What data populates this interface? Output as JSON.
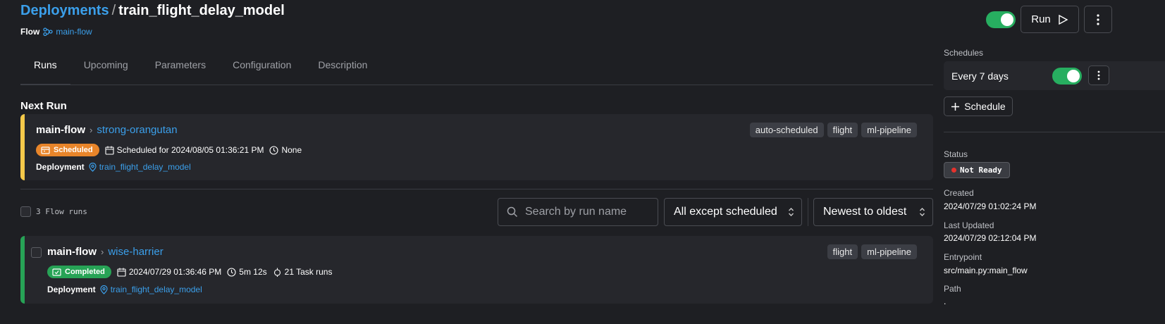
{
  "header": {
    "breadcrumb_root": "Deployments",
    "breadcrumb_sep": "/",
    "deployment_name": "train_flight_delay_model",
    "flow_label": "Flow",
    "flow_name": "main-flow",
    "run_button": "Run"
  },
  "tabs": [
    {
      "label": "Runs",
      "active": true
    },
    {
      "label": "Upcoming"
    },
    {
      "label": "Parameters"
    },
    {
      "label": "Configuration"
    },
    {
      "label": "Description"
    }
  ],
  "next_run": {
    "section_title": "Next Run",
    "flow": "main-flow",
    "run_name": "strong-orangutan",
    "state": "Scheduled",
    "state_color": "#e8852a",
    "scheduled_text": "Scheduled for 2024/08/05 01:36:21 PM",
    "duration": "None",
    "deployment_label": "Deployment",
    "deployment": "train_flight_delay_model",
    "tags": [
      "auto-scheduled",
      "flight",
      "ml-pipeline"
    ]
  },
  "runs_list": {
    "count_label": "3 Flow runs",
    "search_placeholder": "Search by run name",
    "filter_value": "All except scheduled",
    "sort_value": "Newest to oldest"
  },
  "runs": [
    {
      "flow": "main-flow",
      "run_name": "wise-harrier",
      "state": "Completed",
      "state_color": "#27a356",
      "start_time": "2024/07/29 01:36:46 PM",
      "duration": "5m 12s",
      "task_runs": "21 Task runs",
      "deployment_label": "Deployment",
      "deployment": "train_flight_delay_model",
      "tags": [
        "flight",
        "ml-pipeline"
      ]
    }
  ],
  "sidebar": {
    "schedules_label": "Schedules",
    "schedule_text": "Every 7 days",
    "add_schedule": "Schedule",
    "status_label": "Status",
    "status_value": "Not Ready",
    "created_label": "Created",
    "created_value": "2024/07/29 01:02:24 PM",
    "updated_label": "Last Updated",
    "updated_value": "2024/07/29 02:12:04 PM",
    "entrypoint_label": "Entrypoint",
    "entrypoint_value": "src/main.py:main_flow",
    "path_label": "Path",
    "path_value": "."
  },
  "colors": {
    "accent_link": "#3b9fea",
    "toggle_on": "#27ae60",
    "status_dot": "#e5322d"
  }
}
